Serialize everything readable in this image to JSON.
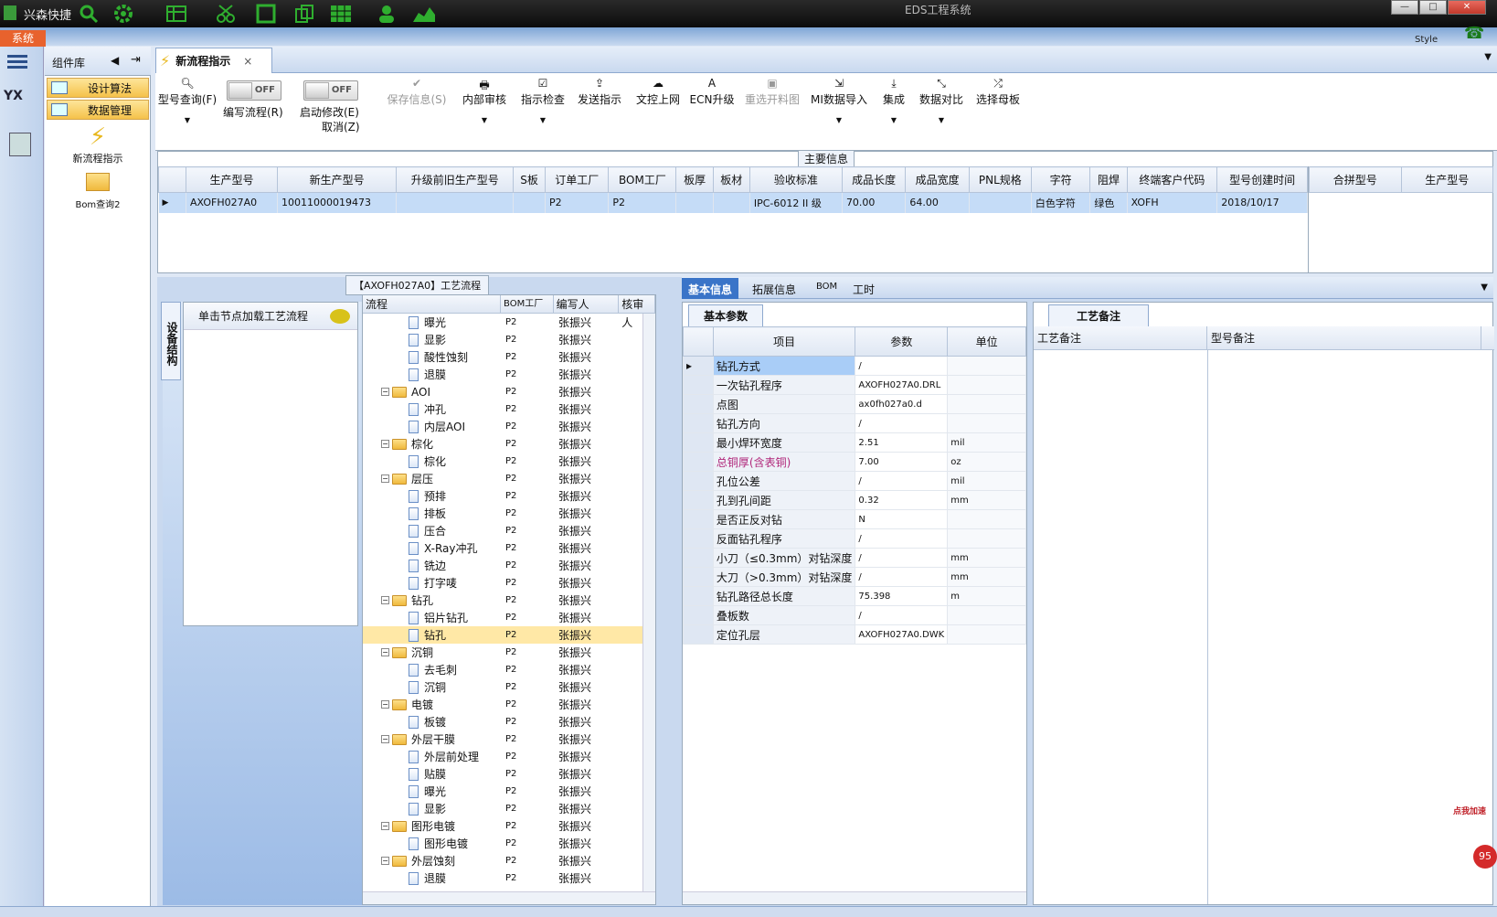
{
  "app": {
    "name": "兴森快捷",
    "window_title": "EDS工程系统",
    "system_tab": "系统",
    "style_label": "Style"
  },
  "library": {
    "title": "组件库",
    "buttons": [
      "设计算法",
      "数据管理"
    ],
    "icons": [
      "新流程指示",
      "Bom查询2"
    ]
  },
  "doc_tab": {
    "label": "新流程指示"
  },
  "toolbar": {
    "model_query": "型号查询(F)",
    "write_flow": "编写流程(R)",
    "start_modify": "启动修改(E)",
    "cancel": "取消(Z)",
    "toggle_off": "OFF",
    "save_info": "保存信息(S)",
    "internal_review": "内部审核",
    "instruction_check": "指示检查",
    "send_instruction": "发送指示",
    "file_upload": "文控上网",
    "ecn_upgrade": "ECN升级",
    "reselect_drawing": "重选开料图",
    "mi_import": "MI数据导入",
    "integrate": "集成",
    "data_compare": "数据对比",
    "select_mother": "选择母板"
  },
  "main_info": {
    "title": "主要信息",
    "columns": [
      "生产型号",
      "新生产型号",
      "升级前旧生产型号",
      "S板",
      "订单工厂",
      "BOM工厂",
      "板厚",
      "板材",
      "验收标准",
      "成品长度",
      "成品宽度",
      "PNL规格",
      "字符",
      "阻焊",
      "终端客户代码",
      "型号创建时间"
    ],
    "row": [
      "AXOFH027A0",
      "10011000019473",
      "",
      "",
      "P2",
      "P2",
      "",
      "",
      "IPC-6012 II 级",
      "70.00",
      "64.00",
      "",
      "白色字符",
      "绿色",
      "XOFH",
      "2018/10/17"
    ],
    "side_columns": [
      "合拼型号",
      "生产型号"
    ]
  },
  "device": {
    "tab": "设备结构",
    "hint": "单击节点加载工艺流程"
  },
  "tree": {
    "title": "【AXOFH027A0】工艺流程",
    "columns": [
      "流程",
      "BOM工厂",
      "编写人",
      "核审人"
    ],
    "rows": [
      {
        "label": "曝光",
        "level": 2,
        "folder": false,
        "bom": "P2",
        "author": "张振兴"
      },
      {
        "label": "显影",
        "level": 2,
        "folder": false,
        "bom": "P2",
        "author": "张振兴"
      },
      {
        "label": "酸性蚀刻",
        "level": 2,
        "folder": false,
        "bom": "P2",
        "author": "张振兴"
      },
      {
        "label": "退膜",
        "level": 2,
        "folder": false,
        "bom": "P2",
        "author": "张振兴"
      },
      {
        "label": "AOI",
        "level": 1,
        "folder": true,
        "bom": "P2",
        "author": "张振兴"
      },
      {
        "label": "冲孔",
        "level": 2,
        "folder": false,
        "bom": "P2",
        "author": "张振兴"
      },
      {
        "label": "内层AOI",
        "level": 2,
        "folder": false,
        "bom": "P2",
        "author": "张振兴"
      },
      {
        "label": "棕化",
        "level": 1,
        "folder": true,
        "bom": "P2",
        "author": "张振兴"
      },
      {
        "label": "棕化",
        "level": 2,
        "folder": false,
        "bom": "P2",
        "author": "张振兴"
      },
      {
        "label": "层压",
        "level": 1,
        "folder": true,
        "bom": "P2",
        "author": "张振兴"
      },
      {
        "label": "预排",
        "level": 2,
        "folder": false,
        "bom": "P2",
        "author": "张振兴"
      },
      {
        "label": "排板",
        "level": 2,
        "folder": false,
        "bom": "P2",
        "author": "张振兴"
      },
      {
        "label": "压合",
        "level": 2,
        "folder": false,
        "bom": "P2",
        "author": "张振兴"
      },
      {
        "label": "X-Ray冲孔",
        "level": 2,
        "folder": false,
        "bom": "P2",
        "author": "张振兴"
      },
      {
        "label": "铣边",
        "level": 2,
        "folder": false,
        "bom": "P2",
        "author": "张振兴"
      },
      {
        "label": "打字唛",
        "level": 2,
        "folder": false,
        "bom": "P2",
        "author": "张振兴"
      },
      {
        "label": "钻孔",
        "level": 1,
        "folder": true,
        "bom": "P2",
        "author": "张振兴"
      },
      {
        "label": "铝片钻孔",
        "level": 2,
        "folder": false,
        "bom": "P2",
        "author": "张振兴"
      },
      {
        "label": "钻孔",
        "level": 2,
        "folder": false,
        "bom": "P2",
        "author": "张振兴",
        "selected": true
      },
      {
        "label": "沉铜",
        "level": 1,
        "folder": true,
        "bom": "P2",
        "author": "张振兴"
      },
      {
        "label": "去毛刺",
        "level": 2,
        "folder": false,
        "bom": "P2",
        "author": "张振兴"
      },
      {
        "label": "沉铜",
        "level": 2,
        "folder": false,
        "bom": "P2",
        "author": "张振兴"
      },
      {
        "label": "电镀",
        "level": 1,
        "folder": true,
        "bom": "P2",
        "author": "张振兴"
      },
      {
        "label": "板镀",
        "level": 2,
        "folder": false,
        "bom": "P2",
        "author": "张振兴"
      },
      {
        "label": "外层干膜",
        "level": 1,
        "folder": true,
        "bom": "P2",
        "author": "张振兴"
      },
      {
        "label": "外层前处理",
        "level": 2,
        "folder": false,
        "bom": "P2",
        "author": "张振兴"
      },
      {
        "label": "贴膜",
        "level": 2,
        "folder": false,
        "bom": "P2",
        "author": "张振兴"
      },
      {
        "label": "曝光",
        "level": 2,
        "folder": false,
        "bom": "P2",
        "author": "张振兴"
      },
      {
        "label": "显影",
        "level": 2,
        "folder": false,
        "bom": "P2",
        "author": "张振兴"
      },
      {
        "label": "图形电镀",
        "level": 1,
        "folder": true,
        "bom": "P2",
        "author": "张振兴"
      },
      {
        "label": "图形电镀",
        "level": 2,
        "folder": false,
        "bom": "P2",
        "author": "张振兴"
      },
      {
        "label": "外层蚀刻",
        "level": 1,
        "folder": true,
        "bom": "P2",
        "author": "张振兴"
      },
      {
        "label": "退膜",
        "level": 2,
        "folder": false,
        "bom": "P2",
        "author": "张振兴"
      }
    ]
  },
  "right_tabs": [
    "基本信息",
    "拓展信息",
    "BOM",
    "工时"
  ],
  "params": {
    "tab": "基本参数",
    "columns": [
      "项目",
      "参数",
      "单位"
    ],
    "rows": [
      {
        "key": "钻孔方式",
        "val": "/",
        "unit": ""
      },
      {
        "key": "一次钻孔程序",
        "val": "AXOFH027A0.DRL",
        "unit": ""
      },
      {
        "key": "点图",
        "val": "ax0fh027a0.d",
        "unit": ""
      },
      {
        "key": "钻孔方向",
        "val": "/",
        "unit": ""
      },
      {
        "key": "最小焊环宽度",
        "val": "2.51",
        "unit": "mil"
      },
      {
        "key": "总铜厚(含表铜)",
        "val": "7.00",
        "unit": "oz",
        "highlight": true
      },
      {
        "key": "孔位公差",
        "val": "/",
        "unit": "mil"
      },
      {
        "key": "孔到孔间距",
        "val": "0.32",
        "unit": "mm"
      },
      {
        "key": "是否正反对钻",
        "val": "N",
        "unit": ""
      },
      {
        "key": "反面钻孔程序",
        "val": "/",
        "unit": ""
      },
      {
        "key": "小刀（≤0.3mm）对钻深度",
        "val": "/",
        "unit": "mm"
      },
      {
        "key": "大刀（>0.3mm）对钻深度",
        "val": "/",
        "unit": "mm"
      },
      {
        "key": "钻孔路径总长度",
        "val": "75.398",
        "unit": "m"
      },
      {
        "key": "叠板数",
        "val": "/",
        "unit": ""
      },
      {
        "key": "定位孔层",
        "val": "AXOFH027A0.DWK",
        "unit": ""
      }
    ]
  },
  "notes": {
    "tab": "工艺备注",
    "columns": [
      "工艺备注",
      "型号备注"
    ]
  },
  "speed_badge": {
    "label": "点我加速",
    "value": "95"
  }
}
